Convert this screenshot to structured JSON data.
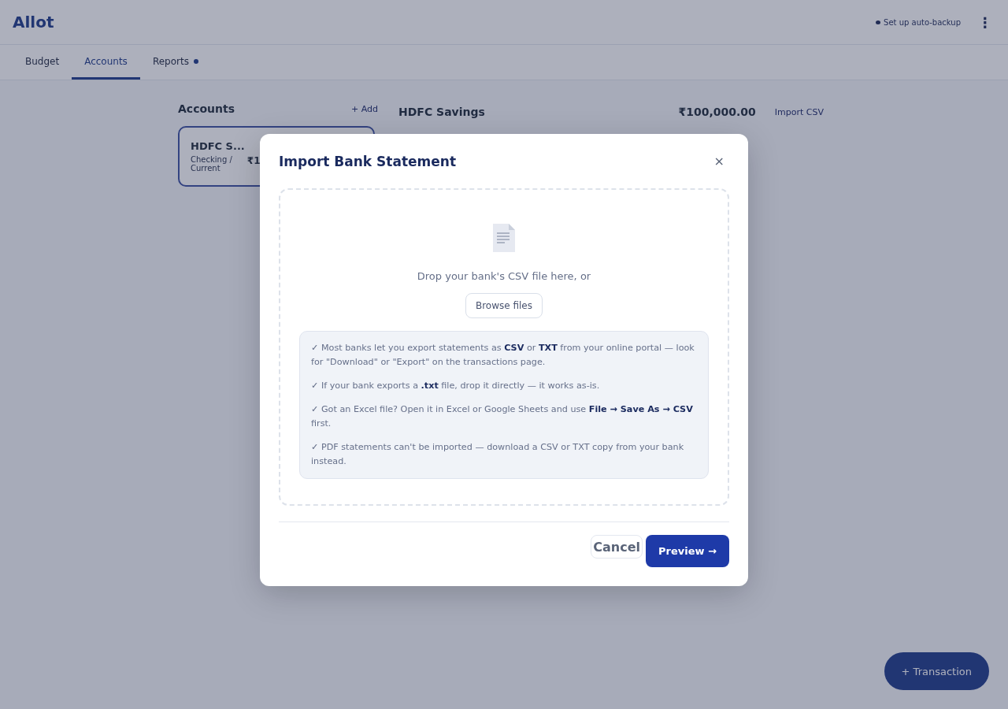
{
  "app": {
    "logo": "Allot",
    "backup_link": "Set up auto-backup",
    "menu_glyph": "⋮"
  },
  "tabs": [
    {
      "label": "Budget",
      "selected": false,
      "dot": false
    },
    {
      "label": "Accounts",
      "selected": true,
      "dot": false
    },
    {
      "label": "Reports",
      "selected": false,
      "dot": true
    }
  ],
  "accounts_panel": {
    "title": "Accounts",
    "add_button": "+ Add",
    "accounts": [
      {
        "name": "HDFC S...",
        "type": "Checking / Current",
        "balance": "₹1",
        "selected": true
      }
    ]
  },
  "account_detail": {
    "title": "HDFC Savings",
    "balance": "₹100,000.00",
    "import_button": "Import CSV"
  },
  "dialog": {
    "title": "Import Bank Statement",
    "close_glyph": "×",
    "drop_text": "Drop your bank's CSV file here, or",
    "browse_button": "Browse files",
    "tips": [
      "✓ Most banks let you export statements as **CSV** or **TXT** from your online portal — look for \"Download\" or \"Export\" on the transactions page.",
      "✓ If your bank exports a **.txt** file, drop it directly — it works as-is.",
      "✓ Got an Excel file? Open it in Excel or Google Sheets and use **File → Save As → CSV** first.",
      "✓ PDF statements can't be imported — download a CSV or TXT copy from your bank instead."
    ],
    "buttons": [
      {
        "label": "Cancel",
        "kind": "secondary"
      },
      {
        "label": "Preview →",
        "kind": "primary"
      }
    ]
  },
  "fab": {
    "label": "+ Transaction"
  }
}
